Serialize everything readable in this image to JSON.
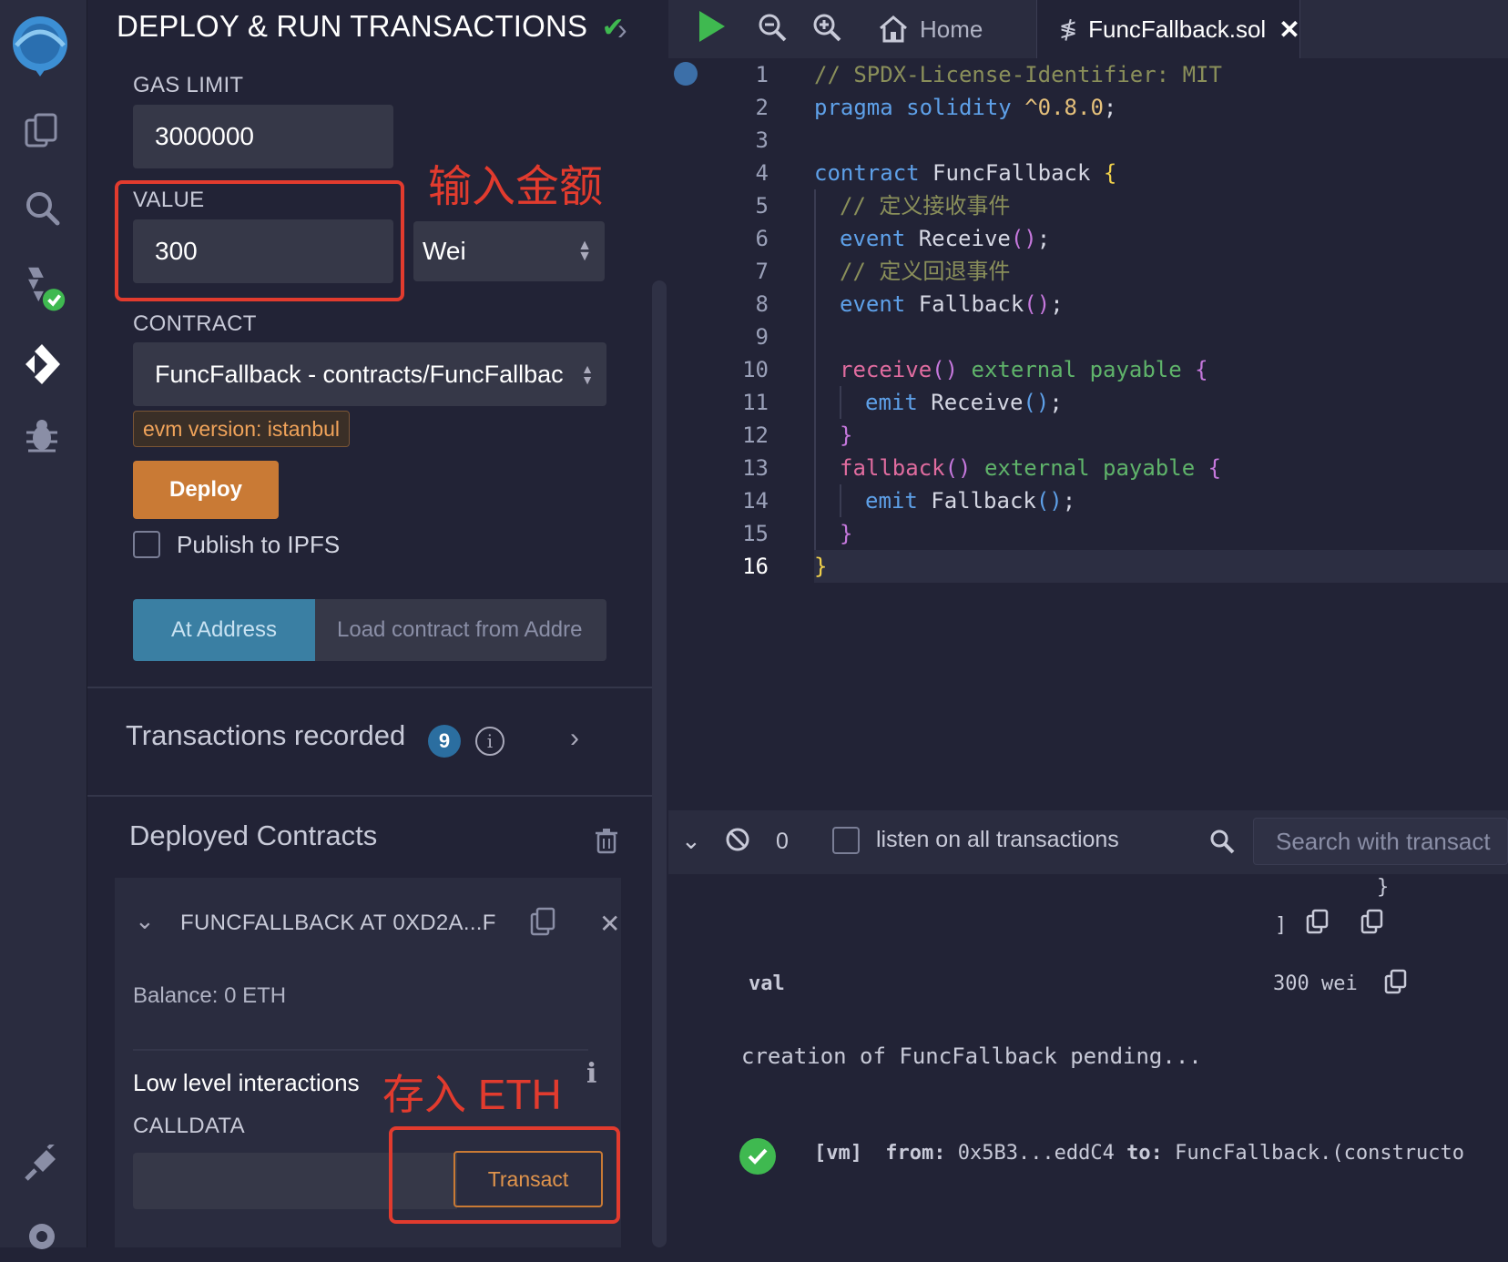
{
  "rail": {
    "icons": [
      "remix-logo-icon",
      "file-explorer-icon",
      "search-icon",
      "solidity-compiler-icon",
      "deploy-run-icon",
      "debugger-icon",
      "plugin-manager-icon",
      "settings-icon"
    ]
  },
  "panel": {
    "title": "DEPLOY & RUN TRANSACTIONS",
    "gas_limit_label": "GAS LIMIT",
    "gas_limit_value": "3000000",
    "value_label": "VALUE",
    "value_value": "300",
    "value_unit": "Wei",
    "annotation_value": "输入金额",
    "contract_label": "CONTRACT",
    "contract_value": "FuncFallback - contracts/FuncFallbac",
    "evm_badge": "evm version: istanbul",
    "deploy_button": "Deploy",
    "publish_label": "Publish to IPFS",
    "at_address_button": "At Address",
    "load_contract_placeholder": "Load contract from Addre",
    "transactions_recorded_label": "Transactions recorded",
    "transactions_recorded_count": "9",
    "deployed_contracts_label": "Deployed Contracts",
    "instance_name": "FUNCFALLBACK AT 0XD2A...F",
    "balance": "Balance: 0 ETH",
    "low_level_label": "Low level interactions",
    "annotation_eth": "存入 ETH",
    "calldata_label": "CALLDATA",
    "transact_button": "Transact"
  },
  "editor": {
    "tabs": [
      {
        "label": "Home",
        "icon": "home-icon"
      },
      {
        "label": "FuncFallback.sol",
        "icon": "solidity-file-icon",
        "active": true
      }
    ],
    "line_numbers": [
      "1",
      "2",
      "3",
      "4",
      "5",
      "6",
      "7",
      "8",
      "9",
      "10",
      "11",
      "12",
      "13",
      "14",
      "15",
      "16"
    ],
    "code": {
      "l1": "// SPDX-License-Identifier: MIT",
      "l2a": "pragma",
      "l2b": "solidity",
      "l2c": "^0.8.0",
      "l2d": ";",
      "l4a": "contract",
      "l4b": "FuncFallback",
      "l4c": "{",
      "l5": "// 定义接收事件",
      "l6a": "event",
      "l6b": "Receive",
      "l6c": "()",
      "l6d": ";",
      "l7": "// 定义回退事件",
      "l8a": "event",
      "l8b": "Fallback",
      "l8c": "()",
      "l8d": ";",
      "l10a": "receive",
      "l10b": "()",
      "l10c": "external",
      "l10d": "payable",
      "l10e": "{",
      "l11a": "emit",
      "l11b": "Receive",
      "l11c": "()",
      "l11d": ";",
      "l12": "}",
      "l13a": "fallback",
      "l13b": "()",
      "l13c": "external",
      "l13d": "payable",
      "l13e": "{",
      "l14a": "emit",
      "l14b": "Fallback",
      "l14c": "()",
      "l14d": ";",
      "l15": "}",
      "l16": "}"
    }
  },
  "terminal": {
    "pending_count": "0",
    "listen_label": "listen on all transactions",
    "search_placeholder": "Search with transact",
    "brace_close": "}",
    "bracket_close": "]",
    "val_key": "val",
    "val_value": "300 wei",
    "creation_msg": "creation of FuncFallback pending...",
    "log_vm": "[vm]",
    "log_from_key": "from:",
    "log_from_val": "0x5B3...eddC4",
    "log_to_key": "to:",
    "log_to_val": "FuncFallback.(constructo"
  },
  "colors": {
    "accent_green": "#3fb950",
    "deploy_orange": "#c97a35",
    "at_address_blue": "#3a7fa3",
    "annotation_red": "#e23b2e",
    "badge_bg": "#3a2f27",
    "badge_text": "#f0a35a"
  }
}
